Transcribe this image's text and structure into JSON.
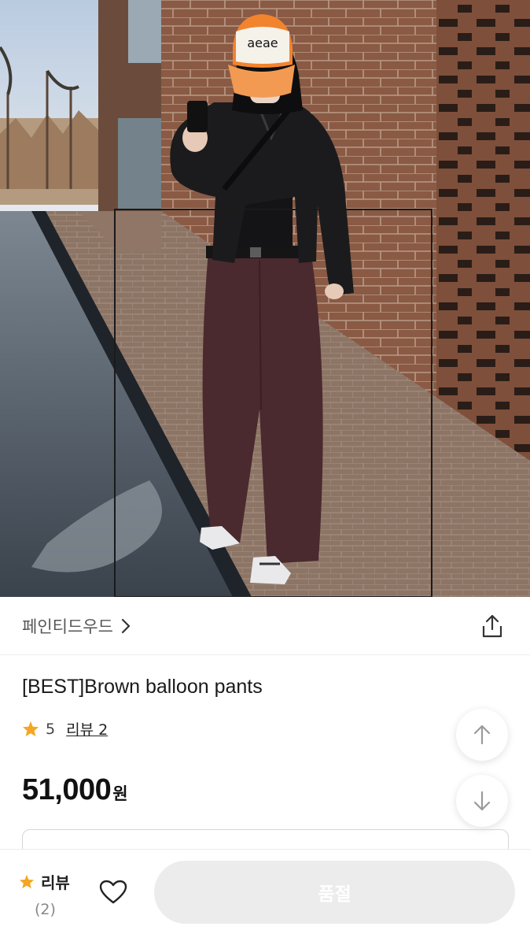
{
  "product_image": {
    "alt": "Model wearing brown balloon pants, black leather jacket and orange cap in front of a brick building",
    "cap_text": "aeae",
    "colors": {
      "sky": "#cfdbe8",
      "brick": "#8a5a44",
      "pavement": "#8d7566",
      "water": "#4d5661",
      "pants": "#4a2a2e",
      "jacket": "#1b1b1d",
      "cap": "#f2842e"
    }
  },
  "brand": {
    "name": "페인티드우드",
    "chevron_icon": "chevron-right-icon"
  },
  "share": {
    "icon": "share-icon"
  },
  "product": {
    "title": "[BEST]Brown balloon pants",
    "rating": "5",
    "review_link": "리뷰 2",
    "price": "51,000",
    "price_unit": "원"
  },
  "scroll": {
    "up_icon": "arrow-up-icon",
    "down_icon": "arrow-down-icon"
  },
  "bottom_bar": {
    "review_label": "리뷰",
    "review_count": "(2)",
    "wishlist_icon": "heart-outline-icon",
    "purchase_label": "품절"
  },
  "colors": {
    "star": "#f5a623",
    "soldout_bg": "#ececed",
    "text_primary": "#1a1a1a",
    "text_secondary": "#555555"
  }
}
